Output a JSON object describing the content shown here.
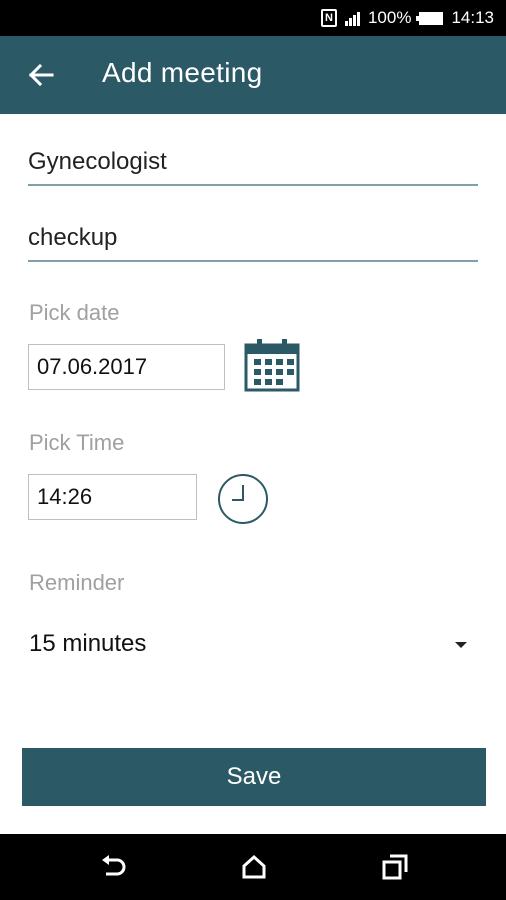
{
  "status_bar": {
    "battery": "100%",
    "time": "14:13"
  },
  "app_bar": {
    "title": "Add meeting"
  },
  "form": {
    "title_value": "Gynecologist",
    "description_value": "checkup",
    "date_label": "Pick date",
    "date_value": "07.06.2017",
    "time_label": "Pick Time",
    "time_value": "14:26",
    "reminder_label": "Reminder",
    "reminder_value": "15 minutes"
  },
  "actions": {
    "save_label": "Save"
  },
  "colors": {
    "primary": "#2b5a66",
    "underline": "#7fa0a8",
    "hint": "#a0a0a0"
  },
  "icons": [
    "nfc-icon",
    "signal-icon",
    "battery-icon",
    "back-arrow-icon",
    "calendar-icon",
    "clock-icon",
    "dropdown-arrow-icon",
    "nav-back-icon",
    "nav-home-icon",
    "nav-recents-icon"
  ]
}
